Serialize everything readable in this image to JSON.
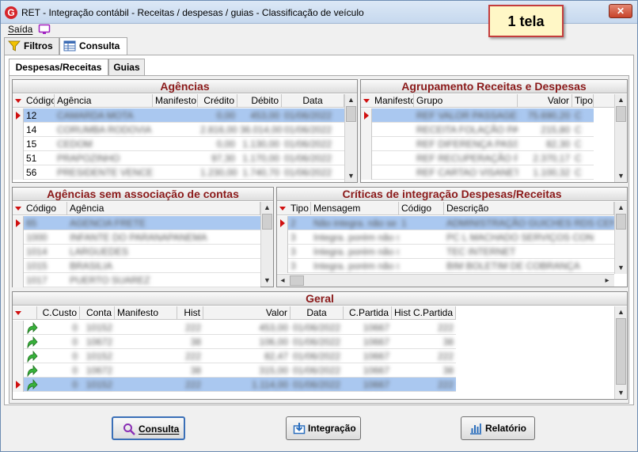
{
  "window": {
    "title": "RET - Integração contábil - Receitas / despesas / guias - Classificação de veículo",
    "logo_letter": "G",
    "close_glyph": "✕"
  },
  "menu": {
    "saida": "Saída"
  },
  "annotation": "1 tela",
  "top_tabs": [
    {
      "label": "Filtros",
      "icon": "filter-icon"
    },
    {
      "label": "Consulta",
      "icon": "table-icon"
    }
  ],
  "sub_tabs": [
    "Despesas/Receitas",
    "Guias"
  ],
  "agencias": {
    "title": "Agências",
    "columns": [
      "Código",
      "Agência",
      "Manifesto",
      "Crédito",
      "Débito",
      "Data"
    ],
    "rows": [
      {
        "codigo": "12",
        "agencia": "CAMARDA MOTA",
        "manifesto": "",
        "credito": "0,00",
        "debito": "453,00",
        "data": "01/06/2022"
      },
      {
        "codigo": "14",
        "agencia": "CORUMBA RODOVIA",
        "manifesto": "",
        "credito": "2.816,00",
        "debito": "36.014,00",
        "data": "01/06/2022"
      },
      {
        "codigo": "15",
        "agencia": "CEDOM",
        "manifesto": "",
        "credito": "0,00",
        "debito": "1.130,00",
        "data": "01/06/2022"
      },
      {
        "codigo": "51",
        "agencia": "PRAPOZINHO",
        "manifesto": "",
        "credito": "97,30",
        "debito": "1.170,00",
        "data": "01/06/2022"
      },
      {
        "codigo": "56",
        "agencia": "PRESIDENTE VENCE",
        "manifesto": "",
        "credito": "1.230,00",
        "debito": "1.740,70",
        "data": "01/06/2022"
      }
    ]
  },
  "agrupamento": {
    "title": "Agrupamento Receitas e Despesas",
    "columns": [
      "Manifesto",
      "Grupo",
      "Valor",
      "Tipo"
    ],
    "rows": [
      {
        "manifesto": "",
        "grupo": "REF VALOR PASSAGEM",
        "valor": "75.690,20",
        "tipo": "C"
      },
      {
        "manifesto": "",
        "grupo": "RECEITA FOLAÇÃO PASS",
        "valor": "215,80",
        "tipo": "C"
      },
      {
        "manifesto": "",
        "grupo": "REF DIFERENÇA PASS",
        "valor": "82,30",
        "tipo": "C"
      },
      {
        "manifesto": "",
        "grupo": "REF RECUPERAÇÃO PASS",
        "valor": "2.370,17",
        "tipo": "C"
      },
      {
        "manifesto": "",
        "grupo": "REF CARTAO VISANET",
        "valor": "1.100,32",
        "tipo": "C"
      }
    ]
  },
  "sem_associacao": {
    "title": "Agências sem associação de contas",
    "columns": [
      "Código",
      "Agência"
    ],
    "rows": [
      {
        "codigo": "65",
        "agencia": "AGENCIA FRETE"
      },
      {
        "codigo": "1000",
        "agencia": "INFANTE DO PARANAPANEMA"
      },
      {
        "codigo": "1014",
        "agencia": "LARGUEDES"
      },
      {
        "codigo": "1015",
        "agencia": "BRASILIA"
      },
      {
        "codigo": "1017",
        "agencia": "PUERTO SUAREZ"
      }
    ]
  },
  "criticas": {
    "title": "Críticas de integração Despesas/Receitas",
    "columns": [
      "Tipo",
      "Mensagem",
      "Código",
      "Descrição"
    ],
    "rows": [
      {
        "tipo": "2",
        "mensagem": "Não integra. não se ap.",
        "codigo": "1",
        "descricao": "ADMINISTRAÇÃO GUICHES RDS CENTRAL"
      },
      {
        "tipo": "3",
        "mensagem": "Integra. porém não se",
        "codigo": "",
        "descricao": "PC L MACHADO SERVIÇOS CON"
      },
      {
        "tipo": "3",
        "mensagem": "Integra. porém não se",
        "codigo": "",
        "descricao": "TEC INTERNET"
      },
      {
        "tipo": "3",
        "mensagem": "Integra. porém não se",
        "codigo": "",
        "descricao": "BIM BOLETIM DE COBRANÇA"
      }
    ]
  },
  "geral": {
    "title": "Geral",
    "columns": [
      "C.Custo",
      "Conta",
      "Manifesto",
      "Hist",
      "Valor",
      "Data",
      "C.Partida",
      "Hist C.Partida"
    ],
    "rows": [
      {
        "ccusto": "0",
        "conta": "10152",
        "manifesto": "",
        "hist": "222",
        "valor": "453,00",
        "data": "01/06/2022",
        "cpartida": "10667",
        "histcp": "222"
      },
      {
        "ccusto": "0",
        "conta": "10672",
        "manifesto": "",
        "hist": "38",
        "valor": "106,00",
        "data": "01/06/2022",
        "cpartida": "10667",
        "histcp": "38"
      },
      {
        "ccusto": "0",
        "conta": "10152",
        "manifesto": "",
        "hist": "222",
        "valor": "82,47",
        "data": "01/06/2022",
        "cpartida": "10667",
        "histcp": "222"
      },
      {
        "ccusto": "0",
        "conta": "10672",
        "manifesto": "",
        "hist": "38",
        "valor": "315,00",
        "data": "01/06/2022",
        "cpartida": "10667",
        "histcp": "38"
      },
      {
        "ccusto": "0",
        "conta": "10152",
        "manifesto": "",
        "hist": "222",
        "valor": "1.114,00",
        "data": "01/06/2022",
        "cpartida": "10667",
        "histcp": "222"
      }
    ]
  },
  "buttons": {
    "consulta": "Consulta",
    "integracao": "Integração",
    "relatorio": "Relatório"
  },
  "colors": {
    "panel_title": "#8b1a1a",
    "selected_row": "#aac8f0",
    "annotation_border": "#c43c3c",
    "row_marker": "#d01010"
  }
}
